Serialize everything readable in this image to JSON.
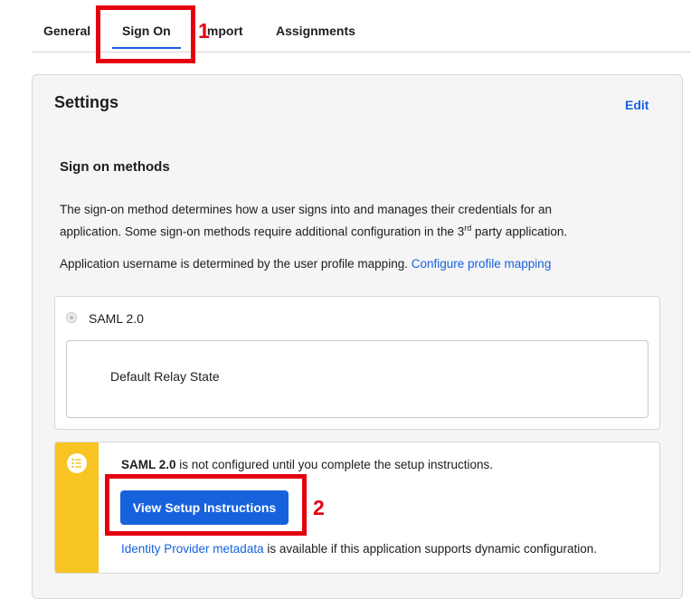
{
  "tabs": [
    {
      "label": "General",
      "active": false
    },
    {
      "label": "Sign On",
      "active": true
    },
    {
      "label": "Import",
      "active": false
    },
    {
      "label": "Assignments",
      "active": false
    }
  ],
  "annotations": {
    "first": "1",
    "second": "2"
  },
  "settings": {
    "title": "Settings",
    "edit_label": "Edit"
  },
  "sign_on_methods": {
    "title": "Sign on methods",
    "description_line1": "The sign-on method determines how a user signs into and manages their credentials for an",
    "description_line2_pre": "application. Some sign-on methods require additional configuration in the 3",
    "description_line2_sup": "rd",
    "description_line2_post": " party application.",
    "username_text": "Application username is determined by the user profile mapping.",
    "username_link": "Configure profile mapping"
  },
  "method": {
    "radio_label": "SAML 2.0",
    "relay_state_label": "Default Relay State"
  },
  "callout": {
    "bold_text": "SAML 2.0",
    "text": " is not configured until you complete the setup instructions.",
    "button_label": "View Setup Instructions",
    "metadata_link": "Identity Provider metadata",
    "metadata_text": " is available if this application supports dynamic configuration.",
    "accent_color": "#f8c422",
    "icon": "list-icon"
  },
  "colors": {
    "brand_blue": "#1662dd",
    "annotation_red": "#e4000f"
  }
}
